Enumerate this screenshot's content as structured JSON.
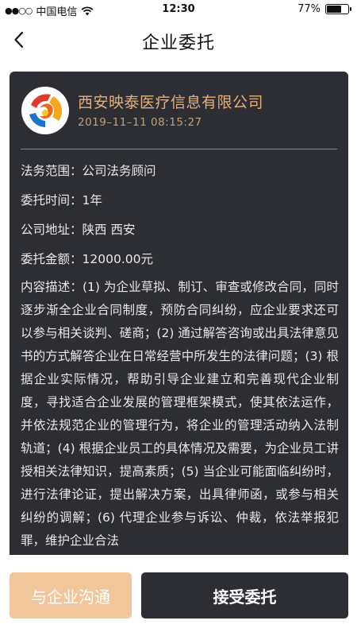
{
  "status_bar": {
    "signal_dots": "●●○○",
    "carrier": "中国电信",
    "time": "12:30",
    "battery_percent": "77%",
    "battery_level": 0.77
  },
  "header": {
    "title": "企业委托"
  },
  "card": {
    "company_name": "西安映泰医疗信息有限公司",
    "datetime": "2019–11–11   08:15:27",
    "fields": [
      {
        "label": "法务范围：",
        "value": "公司法务顾问"
      },
      {
        "label": "委托时间：",
        "value": "1年"
      },
      {
        "label": "公司地址：",
        "value": "陕西 西安"
      },
      {
        "label": "委托金额：",
        "value": "12000.00元"
      }
    ],
    "description_label": "内容描述：",
    "description": "(1) 为企业草拟、制订、审查或修改合同，同时逐步渐全企业合同制度，预防合同纠纷，应企业要求还可以参与相关谈判、磋商；(2) 通过解答咨询或出具法律意见书的方式解答企业在日常经营中所发生的法律问题；(3) 根据企业实际情况，帮助引导企业建立和完善现代企业制度，寻找适合企业发展的管理框架模式，使其依法运作，并依法规范企业的管理行为，将企业的管理活动纳入法制轨道；(4) 根据企业员工的具体情况及需要，为企业员工讲授相关法律知识，提高素质；(5) 当企业可能面临纠纷时，进行法律论证，提出解决方案，出具律师函，或参与相关纠纷的调解；(6) 代理企业参与诉讼、仲裁，依法举报犯罪，维护企业合法"
  },
  "actions": {
    "chat_label": "与企业沟通",
    "accept_label": "接受委托"
  },
  "colors": {
    "card_bg": "#2d2e33",
    "accent_gold": "#e3b179",
    "chat_button": "#f0c69a"
  }
}
